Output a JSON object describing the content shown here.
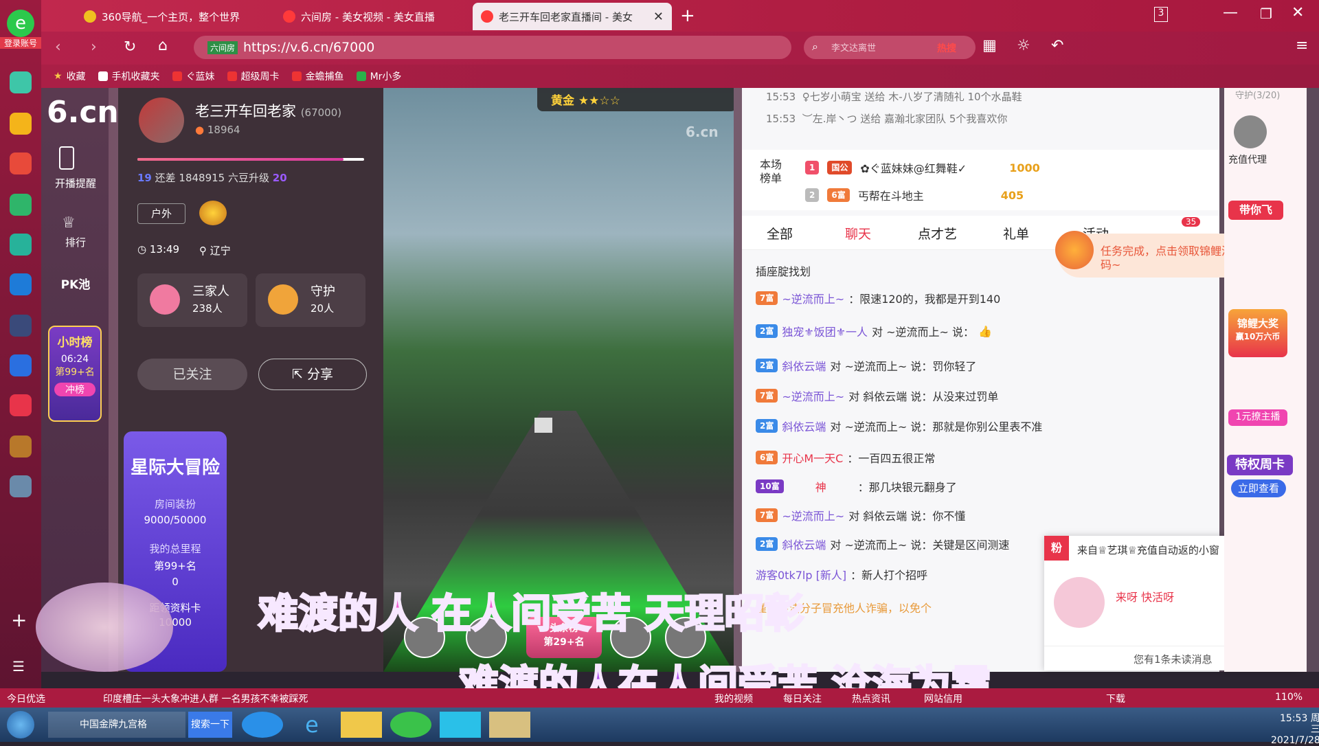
{
  "tabs": [
    {
      "label": "360导航_一个主页，整个世界"
    },
    {
      "label": "六间房 - 美女视频 - 美女直播"
    },
    {
      "label": "老三开车回老家直播间 - 美女"
    }
  ],
  "tab_count": "3",
  "login_label": "登录账号",
  "address": "https://v.6.cn/67000",
  "address_site": "六间房",
  "search_hot": "热搜",
  "search_placeholder": "李文达离世",
  "bookmarks": [
    "收藏",
    "手机收藏夹",
    "ぐ蓝妹",
    "超级周卡",
    "金蟾捕鱼",
    "Mr小多"
  ],
  "sidenav": {
    "start": "开播提醒",
    "rank": "排行",
    "pk": "PK池",
    "hour_rank": "小时榜",
    "hour_time": "06:24",
    "hour_pos": "第99+名",
    "hour_btn": "冲榜"
  },
  "host": {
    "name": "老三开车回老家",
    "id": "(67000)",
    "fans": "18964",
    "level_text": "还差 1848915 六豆升级",
    "level_from": "19",
    "level_to": "20",
    "tag": "户外",
    "time": "13:49",
    "location": "辽宁",
    "family_label": "三家人",
    "family_count": "238人",
    "guard_label": "守护",
    "guard_count": "20人",
    "follow": "已关注",
    "share": "分享"
  },
  "event": {
    "title": "星际大冒险",
    "deco_label": "房间装扮",
    "deco_value": "9000/50000",
    "mileage_label": "我的总里程",
    "mileage_rank": "第99+名",
    "mileage_value": "0",
    "next_label": "距领资料卡",
    "next_value": "10000"
  },
  "video": {
    "badge": "黄金",
    "watermark": "6.cn",
    "top_rank": "头条榜",
    "top_pos": "第29+名"
  },
  "subtitles": [
    "难渡的人 在人间受苦 天理昭彰",
    "难渡的人在人间受苦 沧海为霜"
  ],
  "gifts": [
    {
      "time": "15:53",
      "text": "♀七岁小萌宝 送给 木-八岁了清随礼 10个水晶鞋"
    },
    {
      "time": "15:53",
      "text": "︶左.岸丶つ 送给 嘉瀚北家团队 5个我喜欢你"
    }
  ],
  "board": {
    "title": "本场榜单",
    "rows": [
      {
        "rank": "1",
        "badge": "国公",
        "name": "✿ぐ蓝妹妹@红舞鞋✓",
        "amount": "1000"
      },
      {
        "rank": "2",
        "badge": "6富",
        "name": "丐帮在斗地主",
        "amount": "405"
      }
    ]
  },
  "chat_tabs": [
    "全部",
    "聊天",
    "点才艺",
    "礼单",
    "活动"
  ],
  "activity_count": "35",
  "task_notice": "任务完成，点击领取锦鲤活动幸运码~",
  "chat": [
    {
      "badge": "",
      "name": "插座腚找划",
      "text": ""
    },
    {
      "badge": "7富",
      "name": "~逆流而上~",
      "text": "：限速120的，我都是开到140"
    },
    {
      "badge": "2富",
      "name": "独宠⚜饭团⚜一人",
      "text": "对 ~逆流而上~ 说："
    },
    {
      "badge": "2富",
      "name": "斜依云端",
      "text": "对 ~逆流而上~ 说：罚你轻了"
    },
    {
      "badge": "7富",
      "name": "~逆流而上~",
      "text": "对 斜依云端 说：从没来过罚单"
    },
    {
      "badge": "2富",
      "name": "斜依云端",
      "text": "对 ~逆流而上~ 说：那就是你别公里表不准"
    },
    {
      "badge": "6富",
      "name": "开心M一天C",
      "text": "：一百四五很正常"
    },
    {
      "badge": "10富",
      "name": "神",
      "text": "：那几块银元翻身了"
    },
    {
      "badge": "7富",
      "name": "~逆流而上~",
      "text": "对 斜依云端 说：你不懂"
    },
    {
      "badge": "2富",
      "name": "斜依云端",
      "text": "对 ~逆流而上~ 说：关键是区间测速"
    },
    {
      "badge": "",
      "name": "游客0tk7lp [新人]",
      "text": "：新人打个招呼"
    }
  ],
  "warning": "谨防不法分子冒充他人诈骗，以免个",
  "pm": {
    "from": "来自♕艺琪♕充值自动返的小窗",
    "msg": "来呀 快活呀",
    "unread": "您有1条未读消息"
  },
  "right": {
    "guard": "守护(3/20)",
    "recharge": "充值代理",
    "fly": "带你飞",
    "carp": "锦鲤大奖",
    "carp_sub": "赢10万六币",
    "host1": "1元撩主播",
    "week": "特权周卡",
    "week_btn": "立即查看"
  },
  "statusbar": {
    "news": "印度槽庄一头大象冲进人群 一名男孩不幸被踩死",
    "today": "今日优选",
    "myvideo": "我的视频",
    "follow": "每日关注",
    "hot": "热点资讯",
    "net": "网站信用",
    "download": "下载",
    "zoom": "110%"
  },
  "taskbar": {
    "app1": "中国金牌九宫格",
    "search": "搜索一下",
    "time": "15:53 周三",
    "date": "2021/7/28"
  }
}
